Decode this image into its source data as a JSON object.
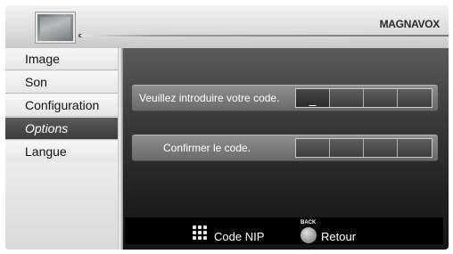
{
  "header": {
    "brand": "MAGNAVOX",
    "tv_icon": "tv-screen-icon"
  },
  "menu": {
    "items": [
      {
        "label": "Image",
        "active": false
      },
      {
        "label": "Son",
        "active": false
      },
      {
        "label": "Configuration",
        "active": false
      },
      {
        "label": "Options",
        "active": true
      },
      {
        "label": "Langue",
        "active": false
      }
    ]
  },
  "main": {
    "enter_code": {
      "label": "Veuillez introduire votre code.",
      "digits": [
        "_",
        "",
        "",
        ""
      ]
    },
    "confirm_code": {
      "label": "Confirmer le code.",
      "digits": [
        "",
        "",
        "",
        ""
      ]
    }
  },
  "bottom_bar": {
    "hints": [
      {
        "icon": "keypad-icon",
        "label": "Code NIP"
      },
      {
        "icon": "back-button-icon",
        "key_label": "BACK",
        "label": "Retour"
      }
    ]
  }
}
